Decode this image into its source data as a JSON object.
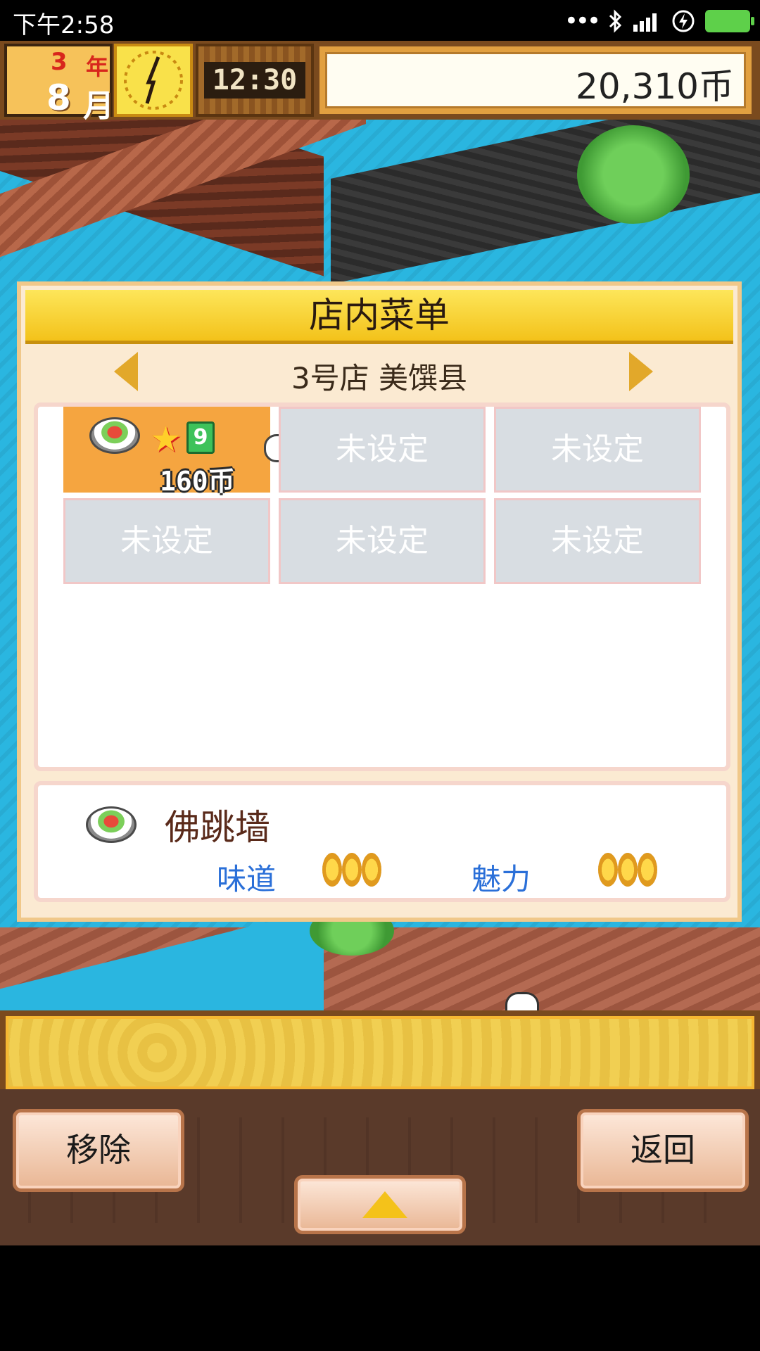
{
  "status_bar": {
    "time": "下午2:58",
    "bluetooth_icon": "bluetooth-icon",
    "signal_icon": "signal-icon",
    "charging_icon": "charging-icon",
    "battery_icon": "battery-icon"
  },
  "hud": {
    "year_num": "3",
    "year_label": "年",
    "month_num": "8",
    "month_label": "月",
    "clock_icon": "clock-icon",
    "time": "12:30",
    "money": "20,310币"
  },
  "menu_panel": {
    "title": "店内菜单",
    "store_name": "3号店 美馔县",
    "prev_icon": "arrow-left-icon",
    "next_icon": "arrow-right-icon",
    "slots": [
      {
        "selected": true,
        "dish_icon": "dish-icon",
        "level": "9",
        "price": "160币"
      },
      {
        "selected": false,
        "label": "未设定"
      },
      {
        "selected": false,
        "label": "未设定"
      },
      {
        "selected": false,
        "label": "未设定"
      },
      {
        "selected": false,
        "label": "未设定"
      },
      {
        "selected": false,
        "label": "未设定"
      }
    ],
    "detail": {
      "dish_name": "佛跳墙",
      "taste_label": "味道",
      "taste_coins": 3,
      "charm_label": "魅力",
      "charm_coins": 3
    }
  },
  "buttons": {
    "remove": "移除",
    "back": "返回",
    "expand_icon": "triangle-up-icon"
  },
  "colors": {
    "header_gold": "#f3c21a",
    "selected_slot": "#f5a540",
    "empty_slot": "#d8dde2",
    "stat_label_blue": "#2a6fd8",
    "water": "#2ab6e0"
  }
}
